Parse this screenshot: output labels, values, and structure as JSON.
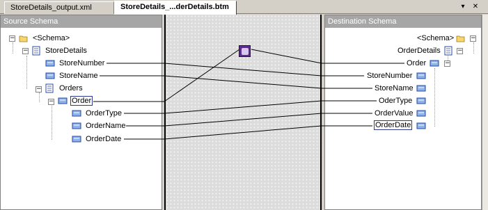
{
  "tabs": [
    {
      "label": "StoreDetails_output.xml",
      "active": false
    },
    {
      "label": "StoreDetails_...derDetails.btm",
      "active": true
    }
  ],
  "window_controls": {
    "dropdown_icon": "chevron-down-icon",
    "close_icon": "close-icon"
  },
  "source_pane": {
    "header": "Source Schema",
    "nodes": {
      "schema": "<Schema>",
      "store_details": "StoreDetails",
      "store_number": "StoreNumber",
      "store_name": "StoreName",
      "orders": "Orders",
      "order": "Order",
      "order_type": "OrderType",
      "order_name": "OrderName",
      "order_date": "OrderDate"
    }
  },
  "destination_pane": {
    "header": "Destination Schema",
    "nodes": {
      "schema": "<Schema>",
      "order_details": "OrderDetails",
      "order": "Order",
      "store_number": "StoreNumber",
      "store_name": "StoreName",
      "oder_type": "OderType",
      "order_value": "OrderValue",
      "order_date": "OrderDate"
    }
  },
  "functoid": {
    "icon": "string-concatenate-functoid-icon"
  },
  "colors": {
    "grid_background": "#dcdcdc",
    "header_gray": "#a6a6a6",
    "functoid_purple": "#5b2c8a",
    "link": "#000000"
  }
}
